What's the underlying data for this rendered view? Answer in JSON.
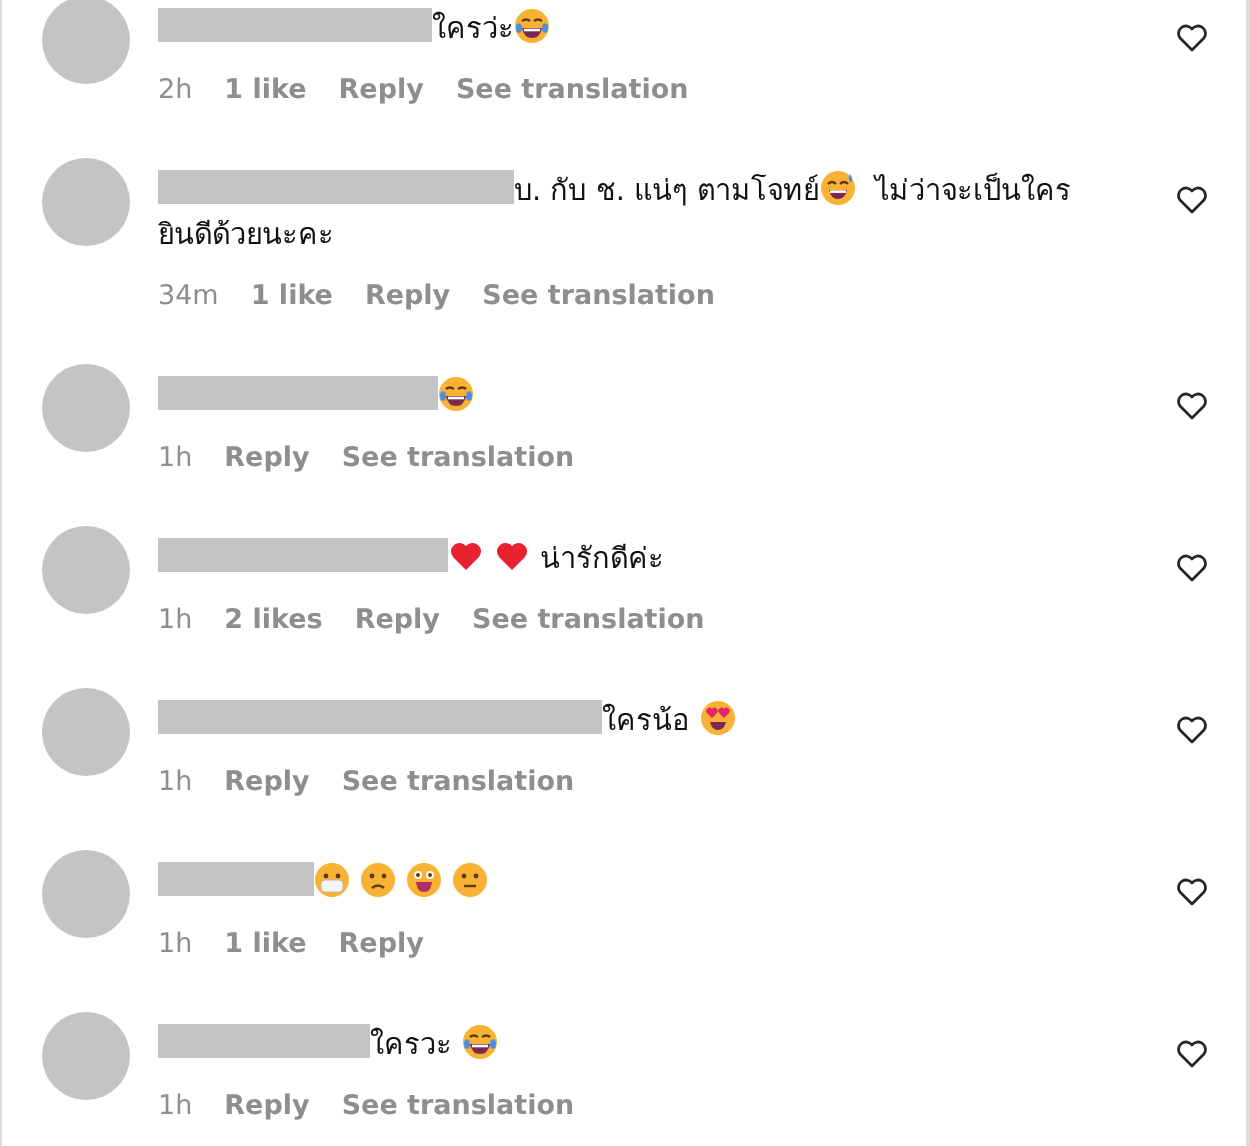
{
  "comments": [
    {
      "body": [
        {
          "kind": "text",
          "text": "ใครว่ะ"
        },
        {
          "kind": "laughing"
        }
      ],
      "time": "2h",
      "likes": "1 like",
      "actions": [
        "Reply",
        "See translation"
      ]
    },
    {
      "body": [
        {
          "kind": "text",
          "text": "บ. กับ ช. แน่ๆ ตามโจทย์"
        },
        {
          "kind": "sweat-smile"
        },
        {
          "kind": "text",
          "text": " ไม่ว่าจะเป็นใคร ยินดีด้วยนะคะ"
        }
      ],
      "time": "34m",
      "likes": "1 like",
      "actions": [
        "Reply",
        "See translation"
      ]
    },
    {
      "body": [
        {
          "kind": "laughing"
        }
      ],
      "time": "1h",
      "actions": [
        "Reply",
        "See translation"
      ]
    },
    {
      "body": [
        {
          "kind": "heart"
        },
        {
          "kind": "heart"
        },
        {
          "kind": "text",
          "text": "น่ารักดีค่ะ"
        }
      ],
      "time": "1h",
      "likes": "2 likes",
      "actions": [
        "Reply",
        "See translation"
      ]
    },
    {
      "body": [
        {
          "kind": "text",
          "text": "ใครน้อ "
        },
        {
          "kind": "heart-eyes"
        }
      ],
      "time": "1h",
      "actions": [
        "Reply",
        "See translation"
      ]
    },
    {
      "body": [
        {
          "kind": "mask"
        },
        {
          "kind": "frown"
        },
        {
          "kind": "grin"
        },
        {
          "kind": "neutral"
        }
      ],
      "time": "1h",
      "likes": "1 like",
      "actions": [
        "Reply"
      ]
    },
    {
      "body": [
        {
          "kind": "text",
          "text": "ใครวะ "
        },
        {
          "kind": "laughing"
        }
      ],
      "time": "1h",
      "actions": [
        "Reply",
        "See translation"
      ]
    }
  ]
}
